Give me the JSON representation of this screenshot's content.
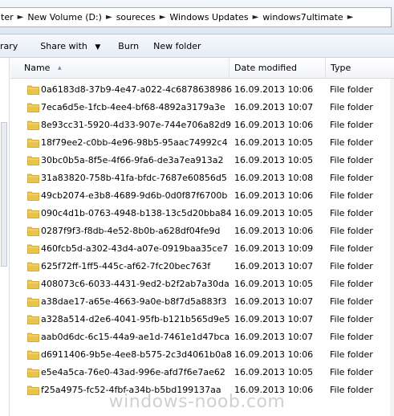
{
  "address": {
    "crumbs": [
      "ter",
      "New Volume (D:)",
      "soureces",
      "Windows Updates",
      "windows7ultimate"
    ],
    "separator": "►"
  },
  "toolbar": {
    "library_label": "rary",
    "share_label": "Share with",
    "burn_label": "Burn",
    "new_folder_label": "New folder"
  },
  "columns": {
    "name": "Name",
    "date": "Date modified",
    "type": "Type"
  },
  "rows": [
    {
      "name": "0a6183d8-37b9-4e47-a022-4c6878638986",
      "date": "16.09.2013 10:06",
      "type": "File folder"
    },
    {
      "name": "7eca6d5e-1fcb-4ee4-bf68-4892a3179a3e",
      "date": "16.09.2013 10:07",
      "type": "File folder"
    },
    {
      "name": "8e93cc31-5920-4d33-907e-744e706a82d9",
      "date": "16.09.2013 10:06",
      "type": "File folder"
    },
    {
      "name": "18f79ee2-c0bb-4e96-98b5-95aac74992c4",
      "date": "16.09.2013 10:05",
      "type": "File folder"
    },
    {
      "name": "30bc0b5a-8f5e-4f66-9fa6-de3a7ea913a2",
      "date": "16.09.2013 10:05",
      "type": "File folder"
    },
    {
      "name": "31a83820-758b-41fa-bfdc-7687e60856d5",
      "date": "16.09.2013 10:08",
      "type": "File folder"
    },
    {
      "name": "49cb2074-e3b8-4689-9d6b-0d0f87f6700b",
      "date": "16.09.2013 10:06",
      "type": "File folder"
    },
    {
      "name": "090c4d1b-0763-4948-b138-13c5d20bba84",
      "date": "16.09.2013 10:05",
      "type": "File folder"
    },
    {
      "name": "0287f9f3-f8db-4e52-8b0b-a628df04fe9d",
      "date": "16.09.2013 10:06",
      "type": "File folder"
    },
    {
      "name": "460fcb5d-a302-43d4-a07e-0919baa35ce7",
      "date": "16.09.2013 10:09",
      "type": "File folder"
    },
    {
      "name": "625f72ff-1ff5-445c-af62-7fc20bec763f",
      "date": "16.09.2013 10:07",
      "type": "File folder"
    },
    {
      "name": "408073c6-6033-4431-9ed2-b2f2ab7a30da",
      "date": "16.09.2013 10:05",
      "type": "File folder"
    },
    {
      "name": "a38dae17-a65e-4663-9a0e-b8f7d5a883f3",
      "date": "16.09.2013 10:07",
      "type": "File folder"
    },
    {
      "name": "a328a514-d2e6-4041-95fb-b121b565d9e5",
      "date": "16.09.2013 10:07",
      "type": "File folder"
    },
    {
      "name": "aab0d6dc-6c15-44a9-ae1d-7461e1d47bca",
      "date": "16.09.2013 10:07",
      "type": "File folder"
    },
    {
      "name": "d6911406-9b5e-4ee8-b575-2c3d4061b0a8",
      "date": "16.09.2013 10:06",
      "type": "File folder"
    },
    {
      "name": "e5e4a5ca-76e0-43ad-996e-afd7f6e7ae62",
      "date": "16.09.2013 10:05",
      "type": "File folder"
    },
    {
      "name": "f25a4975-fc52-4fbf-a34b-b5bd199137aa",
      "date": "16.09.2013 10:06",
      "type": "File folder"
    }
  ],
  "watermark": "windows-noob.com",
  "colors": {
    "folder": "#e8c44a",
    "folder_dark": "#c99a1c"
  }
}
